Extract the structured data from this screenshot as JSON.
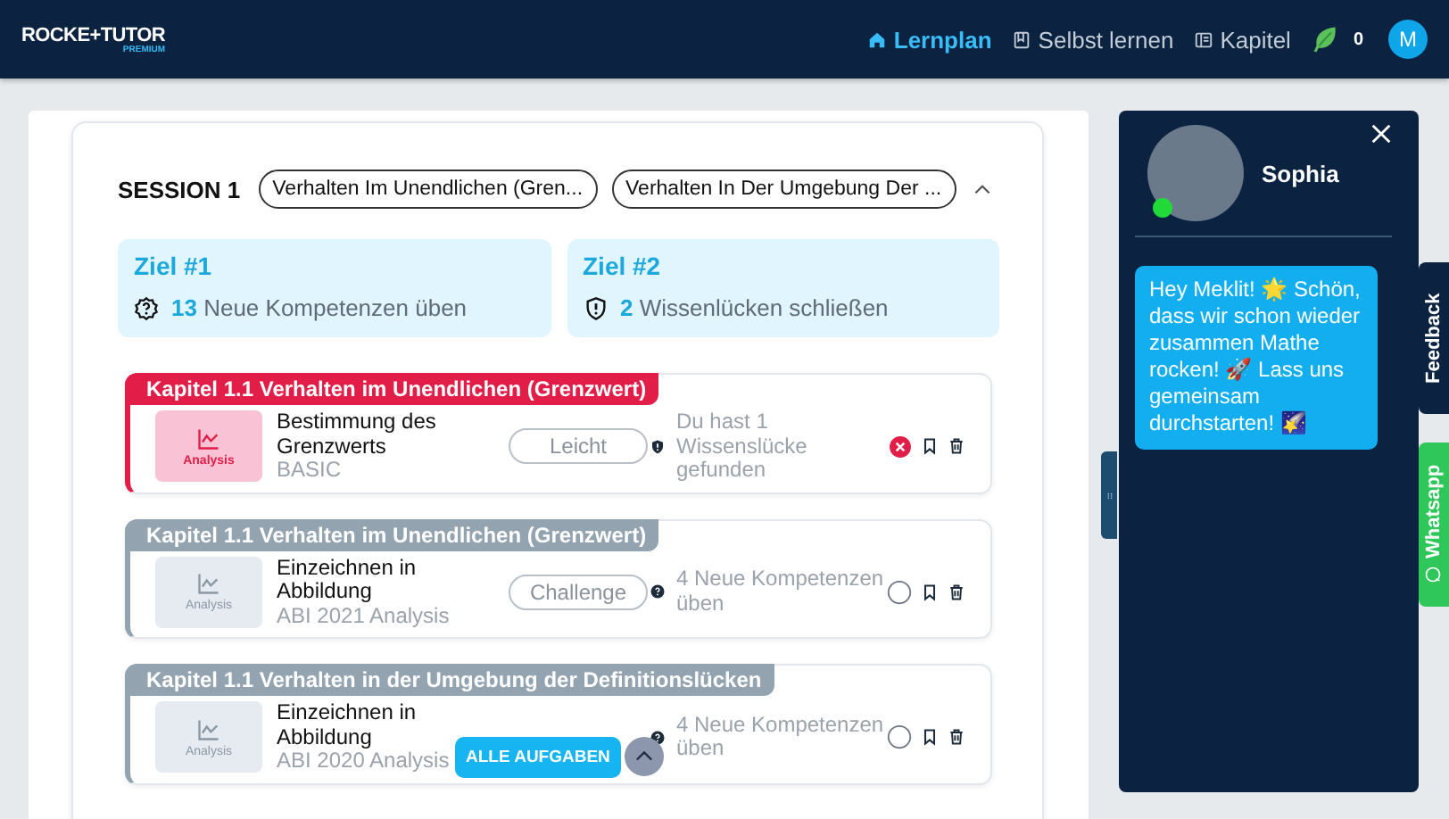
{
  "header": {
    "logo": "ROCKE+TUTOR",
    "logo_tag": "PREMIUM",
    "nav": [
      {
        "label": "Lernplan",
        "kind": "home",
        "selected": true
      },
      {
        "label": "Selbst lernen",
        "kind": "book",
        "selected": false
      },
      {
        "label": "Kapitel",
        "kind": "chapter",
        "selected": false
      }
    ],
    "leaf_count": "0",
    "avatar": "M"
  },
  "session": {
    "title": "SESSION 1",
    "expanded": true,
    "chips": [
      "Verhalten Im Unendlichen (Gren...",
      "Verhalten In Der Umgebung Der ..."
    ],
    "goals": [
      {
        "title": "Ziel #1",
        "kind": "skill",
        "count": "13",
        "text": "Neue Kompetenzen üben"
      },
      {
        "title": "Ziel #2",
        "kind": "gap",
        "count": "2",
        "text": "Wissenlücken schließen"
      }
    ],
    "tasks": [
      {
        "chapter": "Kapitel 1.1 Verhalten im Unendlichen (Grenzwert)",
        "color": "#e11d48",
        "thumb": "Analysis",
        "title": "Bestimmung des Grenzwerts",
        "subtitle": "BASIC",
        "difficulty": "Leicht",
        "info": {
          "kind": "gap",
          "text": "Du hast 1 Wissenslücke gefunden"
        },
        "failed": true
      },
      {
        "chapter": "Kapitel 1.1 Verhalten im Unendlichen (Grenzwert)",
        "color": "#94a3b0",
        "thumb": "Analysis",
        "title": "Einzeichnen in Abbildung",
        "subtitle": "ABI 2021 Analysis",
        "difficulty": "Challenge",
        "info": {
          "kind": "skill",
          "text": "4 Neue Kompetenzen üben"
        },
        "failed": false
      },
      {
        "chapter": "Kapitel 1.1 Verhalten in der Umgebung der Definitionslücken",
        "color": "#94a3b0",
        "thumb": "Analysis",
        "title": "Einzeichnen in Abbildung",
        "subtitle": "ABI 2020 Analysis",
        "info": {
          "kind": "skill",
          "text": "4 Neue Kompetenzen üben"
        },
        "failed": false
      }
    ],
    "all_tasks_button": "ALLE AUFGABEN"
  },
  "chat": {
    "name": "Sophia",
    "online": true,
    "message": "Hey Meklit! 🌟 Schön, dass wir schon wieder zusammen Mathe rocken! 🚀 Lass uns gemeinsam durchstarten! 🌠"
  },
  "side_tabs": [
    {
      "label": "Feedback",
      "kind": "feedback"
    },
    {
      "label": "Whatsapp",
      "kind": "whatsapp"
    }
  ]
}
